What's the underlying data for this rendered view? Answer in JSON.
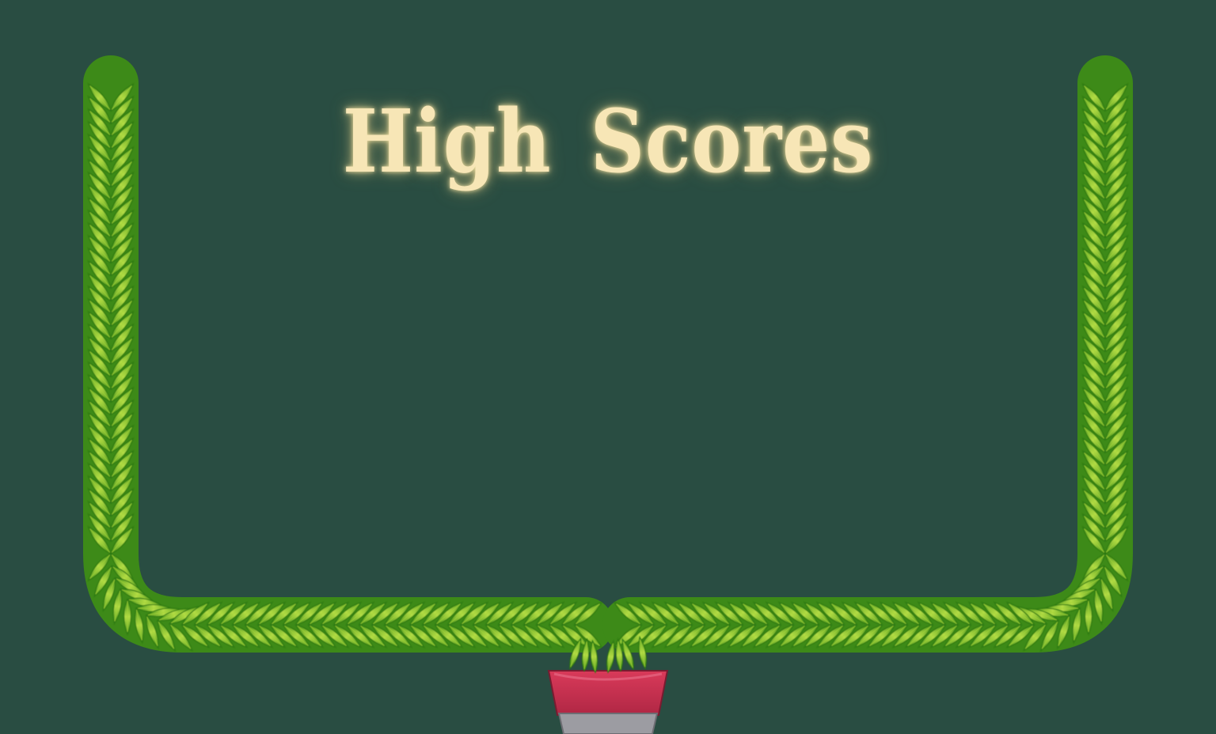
{
  "screen": {
    "name": "high-scores-screen",
    "title": "High Scores"
  },
  "colors": {
    "background": "#294d42",
    "title_text": "#f7e6b6",
    "title_glow": "#ffe39a",
    "leaf_light": "#a6d43a",
    "leaf_mid": "#6fae1c",
    "leaf_dark": "#2f7a12",
    "pot_red": "#c8304f",
    "pot_band": "#9a9aa0"
  },
  "icons": {
    "frame": "leafy-vine-frame",
    "pot": "plant-pot-icon"
  }
}
